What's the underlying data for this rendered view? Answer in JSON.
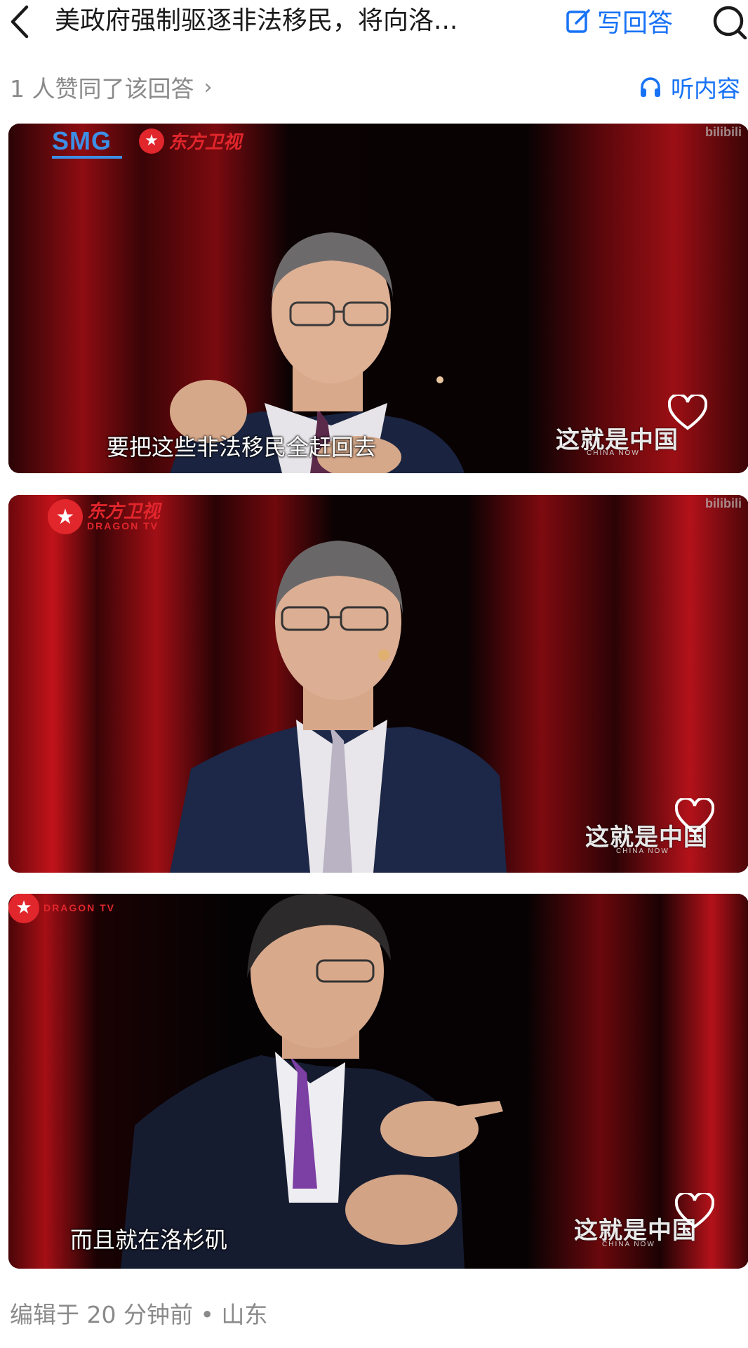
{
  "header": {
    "title": "美政府强制驱逐非法移民，将向洛...",
    "write_answer_label": "写回答"
  },
  "meta": {
    "approvals": "1 人赞同了该回答",
    "listen_label": "听内容"
  },
  "frames": [
    {
      "logo_smg": "SMG",
      "logo_cn": "东方卫视",
      "subtitle": "要把这些非法移民全赶回去",
      "watermark": "这就是中国",
      "watermark_sub": "CHINA NOW",
      "bili": "bilibili"
    },
    {
      "logo_cn": "东方卫视",
      "logo_en": "DRAGON TV",
      "watermark": "这就是中国",
      "watermark_sub": "CHINA NOW",
      "bili": "bilibili"
    },
    {
      "logo_en": "DRAGON TV",
      "subtitle": "而且就在洛杉矶",
      "watermark": "这就是中国",
      "watermark_sub": "CHINA NOW"
    }
  ],
  "footer": {
    "edited": "编辑于 20 分钟前 • 山东"
  },
  "colors": {
    "accent": "#1772f6",
    "muted": "#8a8a8a",
    "curtain": "#9b0f14",
    "dragon_red": "#e1262c"
  },
  "icons": [
    "back-icon",
    "edit-icon",
    "search-icon",
    "chevron-right-icon",
    "headphones-icon",
    "heart-icon",
    "dragon-star-icon"
  ]
}
